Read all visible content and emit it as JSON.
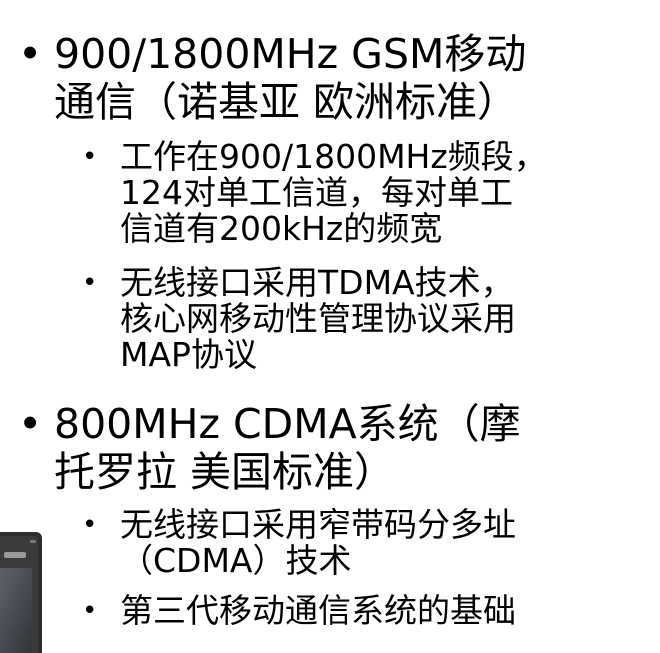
{
  "slide": {
    "items": [
      {
        "bullet": "•",
        "text": "900/1800MHz GSM移动\n通信（诺基亚 欧洲标准）",
        "sub_items": [
          {
            "bullet": "•",
            "text": "工作在900/1800MHz频段，\n124对单工信道，每对单工\n信道有200kHz的频宽"
          },
          {
            "bullet": "•",
            "text": "无线接口采用TDMA技术，\n核心网移动性管理协议采用\nMAP协议"
          }
        ]
      },
      {
        "bullet": "•",
        "text": "800MHz CDMA系统（摩\n托罗拉 美国标准）",
        "sub_items": [
          {
            "bullet": "•",
            "text": "无线接口采用窄带码分多址\n（CDMA）技术"
          },
          {
            "bullet": "•",
            "text": "第三代移动通信系统的基础"
          }
        ]
      }
    ]
  },
  "colors": {
    "text": "#000000",
    "background": "#ffffff",
    "phone_body": "#2e2e2e",
    "phone_screen": "#4a4f55"
  }
}
